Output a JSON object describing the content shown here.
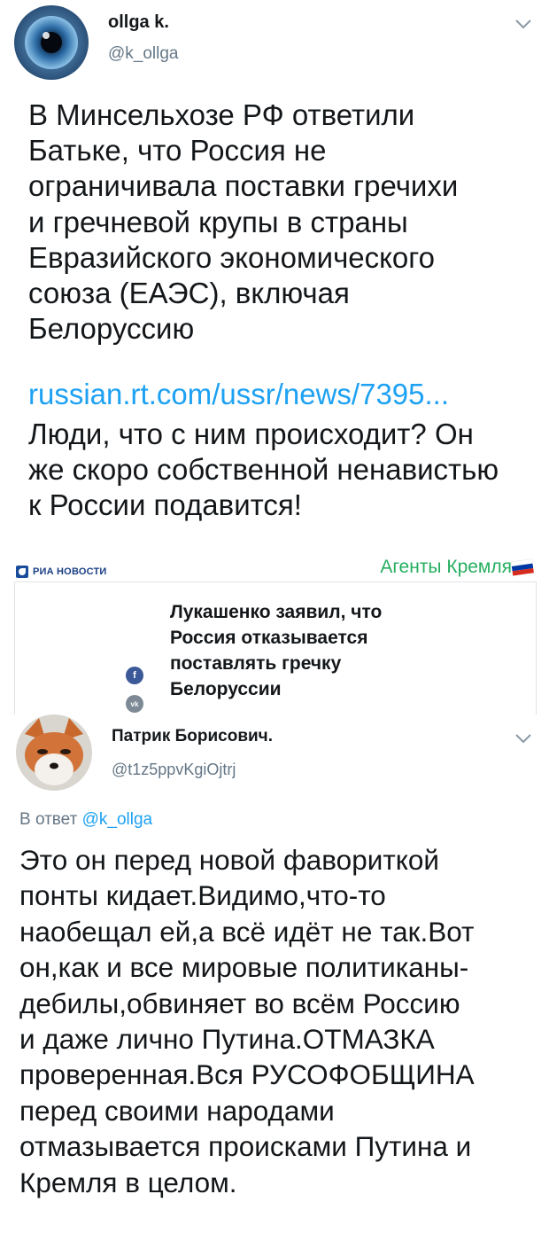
{
  "tweet1": {
    "display_name": "ollga k.",
    "handle": "@k_ollga",
    "text": "В Минсельхозе РФ ответили\nБатьке, что Россия не\nограничивала поставки гречихи\nи гречневой крупы в страны\nЕвразийского экономического\nсоюза (ЕАЭС), включая\nБелоруссию",
    "link": "russian.rt.com/ussr/news/7395...",
    "text2": "Люди, что с ним происходит? Он\nже скоро собственной ненавистью\nк России подавится!"
  },
  "card": {
    "source_logo_text": "РИА НОВОСТИ",
    "watermark": "Агенты Кремля",
    "headline": "Лукашенко заявил, что\nРоссия отказывается\nпоставлять гречку\nБелоруссии",
    "fb_glyph": "f",
    "vk_glyph": "vk",
    "colors": {
      "ria_blue": "#1a4c9c",
      "watermark_green": "#27ae60"
    }
  },
  "tweet2": {
    "display_name": "Патрик Борисович.",
    "handle": "@t1z5ppvKgiOjtrj",
    "reply_prefix": "В ответ",
    "reply_mention": "@k_ollga",
    "text": "Это он перед новой фавориткой\nпонты кидает.Видимо,что-то\nнаобещал ей,а всё идёт не так.Вот\nон,как и все мировые политиканы-\nдебилы,обвиняет во всём Россию\nи даже лично Путина.ОТМАЗКА\nпроверенная.Вся РУСОФОБЩИНА\nперед своими народами\nотмазывается происками Путина и\nКремля в целом."
  },
  "icons": {
    "tweet_menu": "chevron-down-icon",
    "avatar1": "eye-avatar",
    "avatar2": "fox-avatar",
    "facebook": "facebook-icon",
    "vk": "vk-icon",
    "flag": "russian-flag-icon"
  },
  "colors": {
    "link": "#1da1f2",
    "secondary": "#657786",
    "text": "#14171a"
  }
}
